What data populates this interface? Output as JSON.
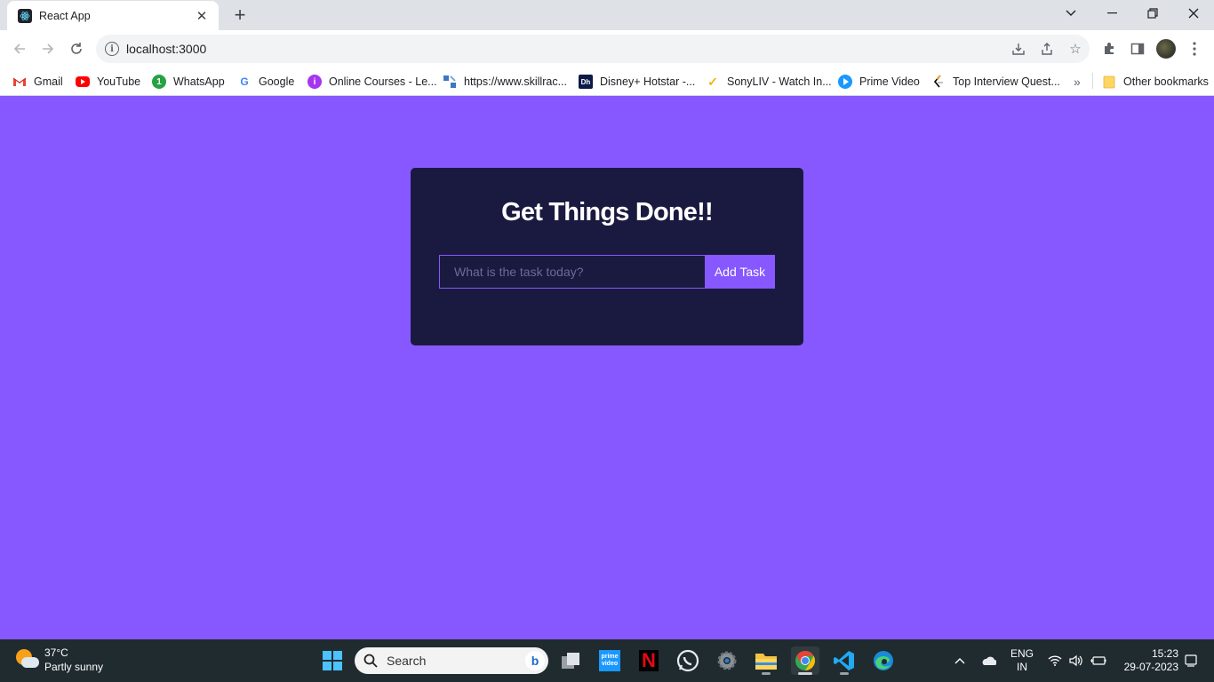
{
  "browser": {
    "tab_title": "React App",
    "url": "localhost:3000"
  },
  "bookmarks": [
    {
      "label": "Gmail",
      "icon": "gmail-icon"
    },
    {
      "label": "YouTube",
      "icon": "youtube-icon"
    },
    {
      "label": "WhatsApp",
      "icon": "whatsapp-icon"
    },
    {
      "label": "Google",
      "icon": "google-icon"
    },
    {
      "label": "Online Courses - Le...",
      "icon": "courses-icon"
    },
    {
      "label": "https://www.skillrac...",
      "icon": "skillrack-icon"
    },
    {
      "label": "Disney+ Hotstar -...",
      "icon": "hotstar-icon"
    },
    {
      "label": "SonyLIV - Watch In...",
      "icon": "sonyliv-icon"
    },
    {
      "label": "Prime Video",
      "icon": "prime-video-icon"
    },
    {
      "label": "Top Interview Quest...",
      "icon": "leetcode-icon"
    }
  ],
  "other_bookmarks": "Other bookmarks",
  "app": {
    "title": "Get Things Done!!",
    "input_placeholder": "What is the task today?",
    "input_value": "",
    "add_button": "Add Task"
  },
  "taskbar": {
    "temperature": "37°C",
    "weather": "Partly sunny",
    "search_label": "Search",
    "lang_top": "ENG",
    "lang_bottom": "IN",
    "time": "15:23",
    "date": "29-07-2023"
  },
  "colors": {
    "page_background": "#8758ff",
    "card_background": "#1a1a40",
    "accent": "#8758ff"
  }
}
